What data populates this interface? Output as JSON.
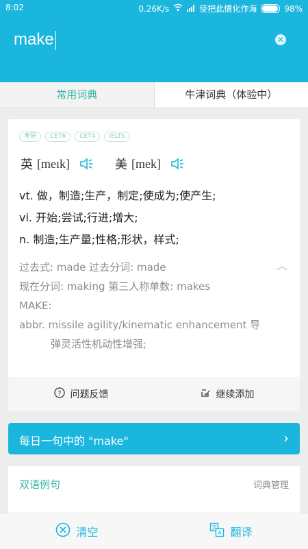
{
  "status": {
    "time": "8:02",
    "network": "0.26K/s",
    "carrier": "使把此情化作海",
    "battery": "98%"
  },
  "search": {
    "query": "make"
  },
  "tabs": [
    {
      "label": "常用词典"
    },
    {
      "label": "牛津词典（体验中）"
    }
  ],
  "entry": {
    "badges": [
      "考研",
      "CET6",
      "CET4",
      "IELTS"
    ],
    "uk_label": "英",
    "uk_ipa": "[meɪk]",
    "us_label": "美",
    "us_ipa": "[mek]",
    "definitions": [
      "vt. 做，制造;生产，制定;使成为;使产生;",
      "vi.  开始;尝试;行进;增大;",
      "n.  制造;生产量;性格;形状，样式;"
    ],
    "forms_line1": "过去式: made    过去分词: made",
    "forms_line2": "现在分词: making    第三人称单数: makes",
    "forms_line3": "MAKE:",
    "forms_line4": "abbr. missile agility/kinematic enhancement 导",
    "forms_line5": "弹灵活性机动性增强;",
    "feedback_label": "问题反馈",
    "add_label": "继续添加"
  },
  "daily": {
    "label": "每日一句中的 \"make\""
  },
  "examples": {
    "title": "双语例句",
    "manage": "词典管理"
  },
  "bottom": {
    "clear_label": "清空",
    "translate_label": "翻译"
  }
}
